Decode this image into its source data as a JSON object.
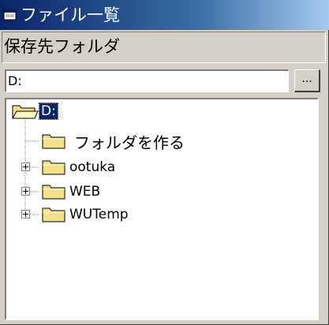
{
  "window": {
    "title": "ファイル一覧",
    "title_icon": "window-icon"
  },
  "folder_label": "保存先フォルダ",
  "path": {
    "value": "D:",
    "browse_label": "..."
  },
  "tree": {
    "root": {
      "label": "D:",
      "icon": "open-folder-icon",
      "selected": true
    },
    "items": [
      {
        "label": "フォルダを作る",
        "icon": "folder-icon",
        "expandable": false
      },
      {
        "label": "ootuka",
        "icon": "folder-icon",
        "expandable": true
      },
      {
        "label": "WEB",
        "icon": "folder-icon",
        "expandable": true
      },
      {
        "label": "WUTemp",
        "icon": "folder-icon",
        "expandable": true
      }
    ]
  },
  "colors": {
    "titlebar_start": "#0a246a",
    "titlebar_end": "#a6caf0",
    "selection": "#0a246a",
    "folder": "#f2e08a"
  }
}
